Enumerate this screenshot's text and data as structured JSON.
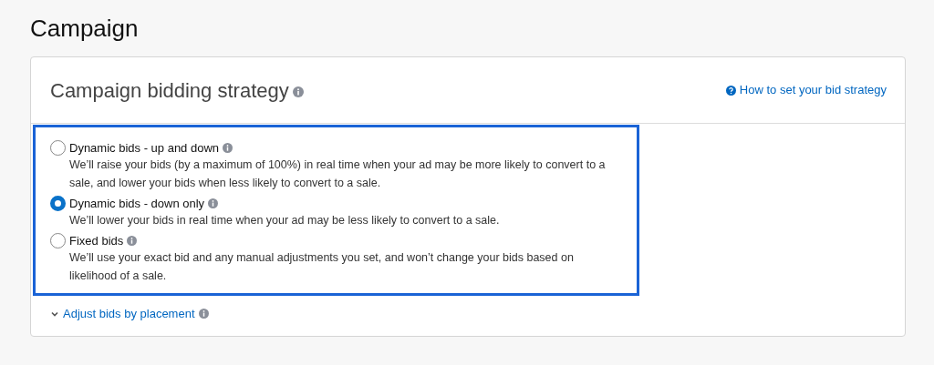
{
  "page_title": "Campaign",
  "card": {
    "title": "Campaign bidding strategy",
    "help_link": "How to set your bid strategy",
    "options": [
      {
        "label": "Dynamic bids - up and down",
        "description": "We’ll raise your bids (by a maximum of 100%) in real time when your ad may be more likely to convert to a sale, and lower your bids when less likely to convert to a sale.",
        "selected": false
      },
      {
        "label": "Dynamic bids - down only",
        "description": "We’ll lower your bids in real time when your ad may be less likely to convert to a sale.",
        "selected": true
      },
      {
        "label": "Fixed bids",
        "description": "We’ll use your exact bid and any manual adjustments you set, and won’t change your bids based on likelihood of a sale.",
        "selected": false
      }
    ],
    "expander": {
      "label": "Adjust bids by placement",
      "expanded": false
    }
  }
}
